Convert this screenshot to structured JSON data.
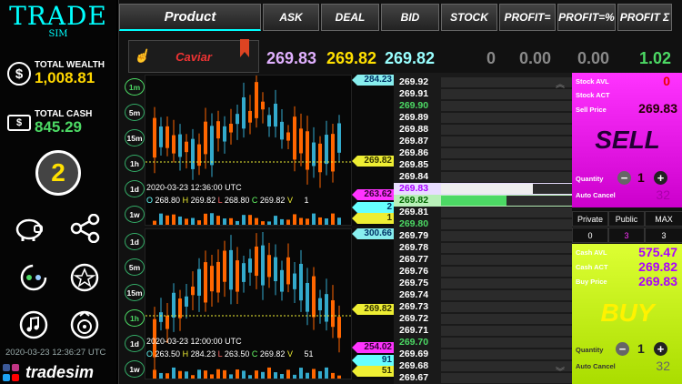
{
  "app": {
    "logo": "TRADE",
    "logo_sub": "SIM",
    "brand": "tradesim",
    "timestamp": "2020-03-23 12:36:27 UTC"
  },
  "sidebar": {
    "wealth": {
      "label": "TOTAL WEALTH",
      "value": "1,008.81",
      "icon": "dollar-coin-icon"
    },
    "cash": {
      "label": "TOTAL CASH",
      "value": "845.29",
      "icon": "cash-bill-icon"
    },
    "level": "2",
    "buttons": [
      {
        "name": "piggy-bank-icon",
        "glyph": "🐖"
      },
      {
        "name": "share-icon",
        "glyph": "⋖"
      },
      {
        "name": "refresh-cycle-icon",
        "glyph": "⟳"
      },
      {
        "name": "star-badge-icon",
        "glyph": "✪"
      },
      {
        "name": "music-note-icon",
        "glyph": "♫"
      },
      {
        "name": "vinyl-disc-icon",
        "glyph": "◉"
      }
    ]
  },
  "topbar": {
    "product": "Product",
    "tabs": [
      "ASK",
      "DEAL",
      "BID",
      "STOCK",
      "PROFIT=",
      "PROFIT=%",
      "PROFIT Σ"
    ]
  },
  "product": {
    "name": "Caviar"
  },
  "ticker": {
    "ask": "269.83",
    "deal": "269.82",
    "bid": "269.82",
    "stock": "0",
    "profit_eq": "0.00",
    "profit_pct": "0.00",
    "profit_sum": "1.02"
  },
  "colors": {
    "ask": "#e0b0ff",
    "deal": "#ffe000",
    "bid": "#9ff",
    "green": "#4cd964",
    "sell": "#ff33ff",
    "buy": "#ccff33"
  },
  "chart_top": {
    "timeframes": [
      "1m",
      "5m",
      "15m",
      "1h",
      "1d",
      "1w"
    ],
    "active": "1m",
    "timestamp": "2020-03-23 12:36:00 UTC",
    "ohlc": {
      "o": "268.80",
      "h": "269.82",
      "l": "268.80",
      "c": "269.82",
      "v": "1"
    },
    "tags": [
      {
        "text": "284.23",
        "color": "#8ee"
      },
      {
        "text": "269.82",
        "color": "#ee3"
      },
      {
        "text": "263.62",
        "color": "#f3f"
      },
      {
        "text": "2",
        "color": "#6ff"
      },
      {
        "text": "1",
        "color": "#ee3"
      }
    ]
  },
  "chart_bottom": {
    "timeframes": [
      "1d",
      "5m",
      "15m",
      "1h",
      "1d",
      "1w"
    ],
    "active": "1h",
    "timestamp": "2020-03-23 12:00:00 UTC",
    "ohlc": {
      "o": "263.50",
      "h": "284.23",
      "l": "263.50",
      "c": "269.82",
      "v": "51"
    },
    "tags": [
      {
        "text": "300.66",
        "color": "#8ee"
      },
      {
        "text": "269.82",
        "color": "#ee3"
      },
      {
        "text": "254.02",
        "color": "#f3f"
      },
      {
        "text": "91",
        "color": "#6ff"
      },
      {
        "text": "51",
        "color": "#ee3"
      }
    ]
  },
  "orderbook": {
    "rows": [
      "269.92",
      "269.91",
      "269.90",
      "269.89",
      "269.88",
      "269.87",
      "269.86",
      "269.85",
      "269.84",
      "269.83",
      "269.82",
      "269.81",
      "269.80",
      "269.79",
      "269.78",
      "269.77",
      "269.76",
      "269.75",
      "269.74",
      "269.73",
      "269.72",
      "269.71",
      "269.70",
      "269.69",
      "269.68",
      "269.67"
    ],
    "green_rows": [
      "269.90",
      "269.80",
      "269.70"
    ],
    "ask_row": "269.83",
    "bid_row": "269.82",
    "ask_fill": 0.7,
    "bid_fill": 0.5
  },
  "sell": {
    "stock_avl_label": "Stock AVL",
    "stock_avl": "0",
    "stock_act_label": "Stock ACT",
    "sell_price_label": "Sell Price",
    "sell_price": "269.83",
    "button": "SELL",
    "quantity_label": "Quantity",
    "quantity": "1",
    "auto_cancel_label": "Auto Cancel",
    "auto_cancel": "32"
  },
  "visibility": {
    "headers": [
      "Private",
      "Public",
      "MAX"
    ],
    "values": [
      "0",
      "3",
      "3"
    ]
  },
  "buy": {
    "cash_avl_label": "Cash AVL",
    "cash_avl": "575.47",
    "cash_act_label": "Cash ACT",
    "cash_act": "269.82",
    "buy_price_label": "Buy Price",
    "buy_price": "269.83",
    "button": "BUY",
    "quantity_label": "Quantity",
    "quantity": "1",
    "auto_cancel_label": "Auto Cancel",
    "auto_cancel": "32"
  }
}
